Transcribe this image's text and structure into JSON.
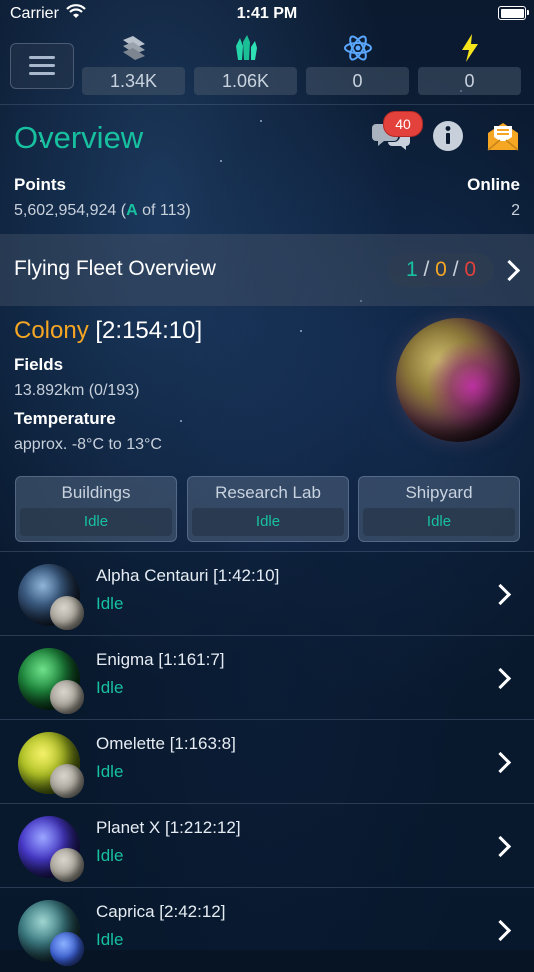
{
  "status_bar": {
    "carrier": "Carrier",
    "time": "1:41 PM"
  },
  "resources": [
    {
      "icon": "metal-icon",
      "value": "1.34K",
      "color": "#c9d3df"
    },
    {
      "icon": "crystal-icon",
      "value": "1.06K",
      "color": "#c9d3df"
    },
    {
      "icon": "deuterium-icon",
      "value": "0",
      "color": "#c9d3df"
    },
    {
      "icon": "energy-icon",
      "value": "0",
      "color": "#17c1a0"
    }
  ],
  "overview": {
    "title": "Overview",
    "chat_badge": "40",
    "points_label": "Points",
    "points_value": "5,602,954,924 (",
    "rank_letter": "A",
    "rank_suffix": " of 113)",
    "online_label": "Online",
    "online_value": "2"
  },
  "fleet": {
    "title": "Flying Fleet Overview",
    "count_own": "1",
    "count_neutral": "0",
    "count_hostile": "0",
    "separator": "/"
  },
  "colony": {
    "type": "Colony",
    "coords": "[2:154:10]",
    "fields_label": "Fields",
    "fields_value": "13.892km (0/193)",
    "temp_label": "Temperature",
    "temp_value": "approx. -8°C to 13°C"
  },
  "construction": [
    {
      "title": "Buildings",
      "status": "Idle"
    },
    {
      "title": "Research Lab",
      "status": "Idle"
    },
    {
      "title": "Shipyard",
      "status": "Idle"
    }
  ],
  "planets": [
    {
      "name": "Alpha Centauri [1:42:10]",
      "status": "Idle"
    },
    {
      "name": "Enigma [1:161:7]",
      "status": "Idle"
    },
    {
      "name": "Omelette [1:163:8]",
      "status": "Idle"
    },
    {
      "name": "Planet X [1:212:12]",
      "status": "Idle"
    },
    {
      "name": "Caprica [2:42:12]",
      "status": "Idle"
    }
  ],
  "colors": {
    "accent": "#17c1a0",
    "orange": "#f5a623",
    "red": "#e3413b"
  }
}
